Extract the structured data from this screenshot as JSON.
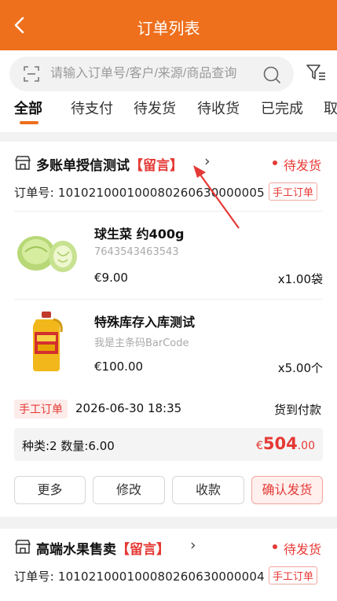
{
  "header": {
    "title": "订单列表"
  },
  "search": {
    "placeholder": "请输入订单号/客户/来源/商品查询"
  },
  "tabs": [
    {
      "label": "全部"
    },
    {
      "label": "待支付"
    },
    {
      "label": "待发货"
    },
    {
      "label": "待收货"
    },
    {
      "label": "已完成"
    },
    {
      "label": "取"
    }
  ],
  "orders": [
    {
      "shop_name": "多账单授信测试",
      "note_tag": "【留言】",
      "status": "待发货",
      "order_no": "订单号: 101021000100080260630000005",
      "order_tag": "手工订单",
      "items": [
        {
          "name": "球生菜 约400g",
          "code": "7643543463543",
          "price": "€9.00",
          "qty": "x1.00袋"
        },
        {
          "name": "特殊库存入库测试",
          "code": "我是主条码BarCode",
          "price": "€100.00",
          "qty": "x5.00个"
        }
      ],
      "type_pill": "手工订单",
      "time": "2026-06-30 18:35",
      "pay_method": "货到付款",
      "summary": "种类:2  数量:6.00",
      "amount_currency": "€",
      "amount_int": "504",
      "amount_dec": ".00",
      "buttons": {
        "more": "更多",
        "edit": "修改",
        "collect": "收款",
        "confirm": "确认发货"
      }
    },
    {
      "shop_name": "高端水果售卖",
      "note_tag": "【留言】",
      "status": "待发货",
      "order_no": "订单号: 101021000100080260630000004",
      "order_tag": "手工订单"
    }
  ],
  "colors": {
    "brand": "#ee6f1c",
    "accent_red": "#e53935"
  }
}
